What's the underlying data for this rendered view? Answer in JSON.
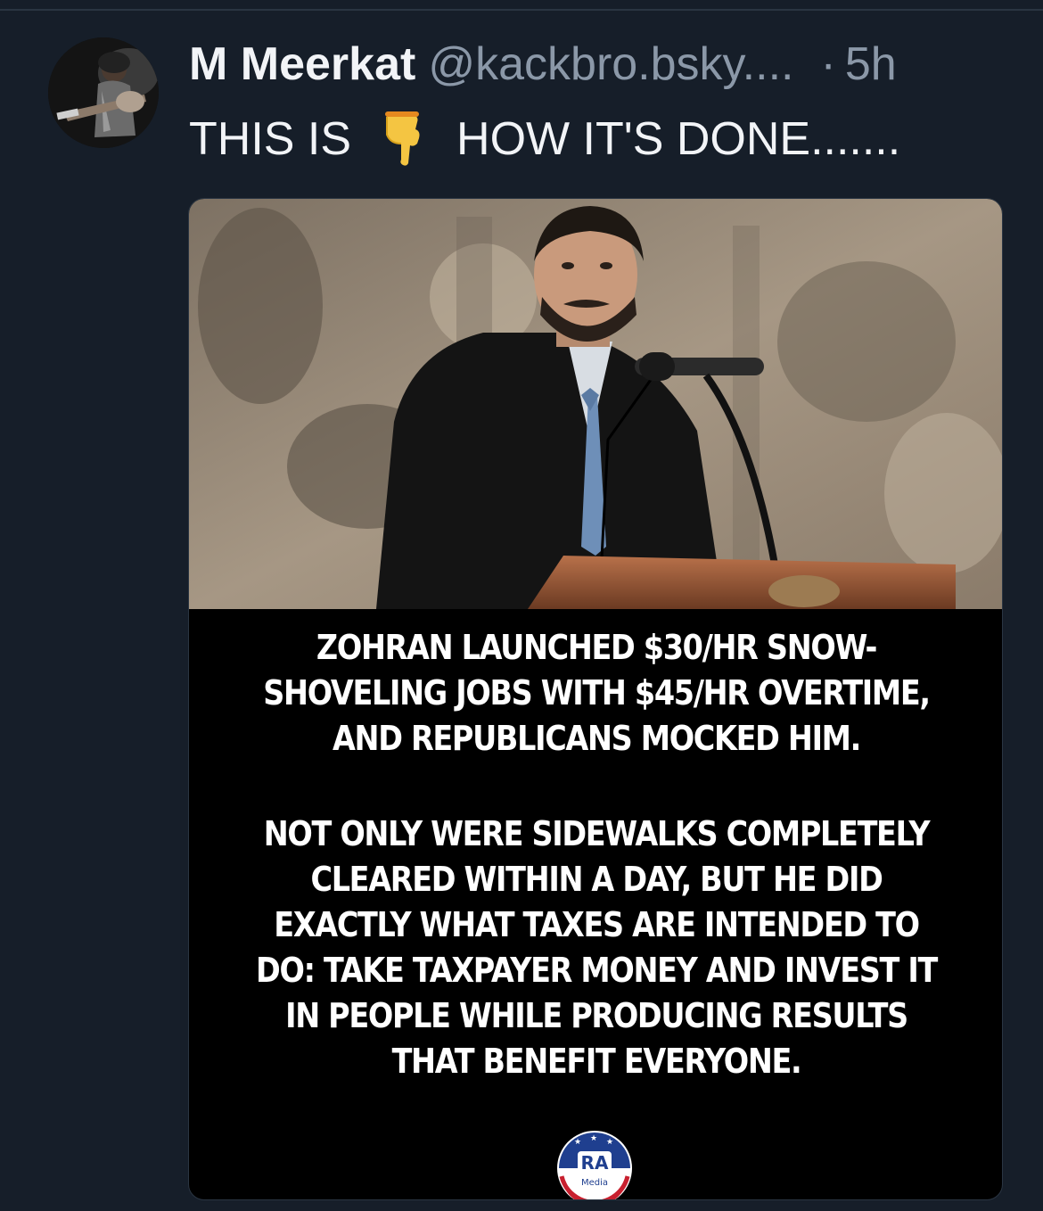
{
  "post": {
    "author": {
      "display_name": "M Meerkat",
      "handle": "@kackbro.bsky....",
      "avatar_icon": "avatar-guitarist-photo"
    },
    "separator": "·",
    "timestamp": "5h",
    "text_before_emoji": "THIS IS",
    "emoji_icon": "backhand-index-pointing-down-icon",
    "text_after_emoji": "HOW IT'S DONE.......",
    "embed": {
      "photo_icon": "man-at-podium-photo",
      "caption_paragraph_1": [
        "ZOHRAN LAUNCHED $30/HR SNOW-",
        "SHOVELING JOBS WITH $45/HR OVERTIME,",
        "AND REPUBLICANS MOCKED HIM."
      ],
      "caption_paragraph_2": [
        "NOT ONLY WERE SIDEWALKS COMPLETELY",
        "CLEARED WITHIN A DAY, BUT HE DID",
        "EXACTLY WHAT TAXES ARE INTENDED TO",
        "DO: TAKE TAXPAYER MONEY AND INVEST IT",
        "IN PEOPLE WHILE PRODUCING RESULTS",
        "THAT BENEFIT EVERYONE."
      ],
      "logo": {
        "text_main": "RA",
        "text_sub": "Media",
        "colors": {
          "blue": "#1f3f8f",
          "red": "#c8202f",
          "white": "#ffffff"
        }
      }
    }
  },
  "colors": {
    "background": "#161e29",
    "primary_text": "#f2f4f7",
    "secondary_text": "#8b98a8",
    "emoji_yellow": "#f4c542"
  }
}
